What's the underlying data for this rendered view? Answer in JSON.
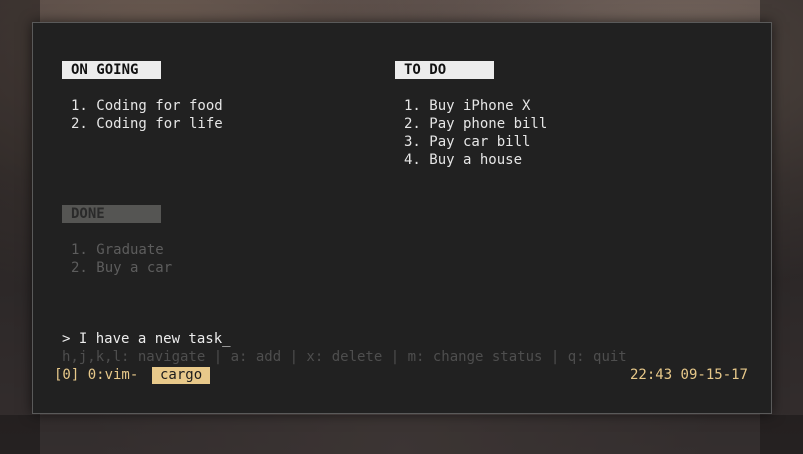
{
  "app": {
    "name": "cargo"
  },
  "sections": {
    "ongoing": {
      "title": "ON GOING",
      "items": [
        "1. Coding for food",
        "2. Coding for life"
      ]
    },
    "todo": {
      "title": "TO DO",
      "items": [
        "1. Buy iPhone X",
        "2. Pay phone bill",
        "3. Pay car bill",
        "4. Buy a house"
      ]
    },
    "done": {
      "title": "DONE",
      "items": [
        "1. Graduate",
        "2. Buy a car"
      ]
    }
  },
  "input": {
    "prompt": "> ",
    "value": "I have a new task",
    "cursor": "_"
  },
  "help_text": "h,j,k,l: navigate | a: add | x: delete | m: change status | q: quit",
  "statusbar": {
    "session": "[0] 0:vim-",
    "active_window": "cargo",
    "time_date": "22:43 09-15-17"
  },
  "colors": {
    "terminal_bg": "#212121",
    "header_active_bg": "#ececec",
    "header_done_bg": "#555553",
    "statusbar_accent": "#e8c98a"
  }
}
